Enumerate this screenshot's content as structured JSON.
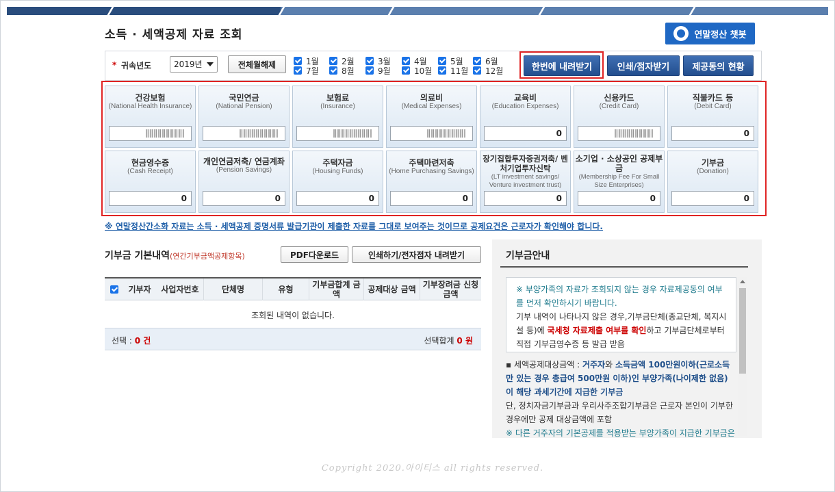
{
  "page": {
    "title": "소득 · 세액공제 자료 조회",
    "chatbot_label": "연말정산 챗봇"
  },
  "filter": {
    "required_mark": "*",
    "year_label": "귀속년도",
    "year_value": "2019년",
    "toggle_all_label": "전체월해제",
    "months": [
      "1월",
      "2월",
      "3월",
      "4월",
      "5월",
      "6월",
      "7월",
      "8월",
      "9월",
      "10월",
      "11월",
      "12월"
    ],
    "download_all_label": "한번에 내려받기",
    "print_label": "인쇄/점자받기",
    "provider_label": "제공동의 현황"
  },
  "cards": [
    {
      "title": "건강보험",
      "en": "(National Health Insurance)",
      "value": "",
      "masked": true
    },
    {
      "title": "국민연금",
      "en": "(National Pension)",
      "value": "",
      "masked": true
    },
    {
      "title": "보험료",
      "en": "(Insurance)",
      "value": "",
      "masked": true
    },
    {
      "title": "의료비",
      "en": "(Medical Expenses)",
      "value": "",
      "masked": true
    },
    {
      "title": "교육비",
      "en": "(Education Expenses)",
      "value": "0",
      "masked": false
    },
    {
      "title": "신용카드",
      "en": "(Credit Card)",
      "value": "",
      "masked": true
    },
    {
      "title": "직불카드 등",
      "en": "(Debit Card)",
      "value": "0",
      "masked": false
    },
    {
      "title": "현금영수증",
      "en": "(Cash Receipt)",
      "value": "0",
      "masked": false
    },
    {
      "title": "개인연금저축/ 연금계좌",
      "en": "(Pension Savings)",
      "value": "0",
      "masked": false
    },
    {
      "title": "주택자금",
      "en": "(Housing Funds)",
      "value": "0",
      "masked": false
    },
    {
      "title": "주택마련저축",
      "en": "(Home Purchasing Savings)",
      "value": "0",
      "masked": false
    },
    {
      "title": "장기집합투자증권저축/ 벤처기업투자신탁",
      "en": "(LT investment savings/ Venture investment trust)",
      "value": "0",
      "masked": false
    },
    {
      "title": "소기업 · 소상공인 공제부금",
      "en": "(Membership Fee For Small Size Enterprises)",
      "value": "0",
      "masked": false
    },
    {
      "title": "기부금",
      "en": "(Donation)",
      "value": "0",
      "masked": false
    }
  ],
  "notice": "※ 연말정산간소화 자료는 소득 · 세액공제 증명서류 발급기관이 제출한 자료를 그대로 보여주는 것이므로 공제요건은 근로자가 확인해야 합니다.",
  "donation": {
    "title": "기부금 기본내역",
    "subtitle": "(연간기부금액공제항목)",
    "pdf_label": "PDF다운로드",
    "print_label": "인쇄하기/전자점자 내려받기",
    "columns": [
      "기부자",
      "사업자번호",
      "단체명",
      "유형",
      "기부금합계 금액",
      "공제대상 금액",
      "기부장려금 신청금액"
    ],
    "empty_message": "조회된 내역이 없습니다.",
    "footer_selected_label": "선택 :",
    "footer_selected_count": "0 건",
    "footer_sum_label": "선택합계",
    "footer_sum_value": "0 원"
  },
  "guide": {
    "title": "기부금안내",
    "box_line1": "※ 부양가족의 자료가 조회되지 않는 경우 자료제공동의 여부를 먼저 확인하시기 바랍니다.",
    "box_line2_a": "기부 내역이 나타나지 않은 경우,기부금단체(종교단체, 복지시설 등)에 ",
    "box_line2_b": "국세청 자료제출 여부를 확인",
    "box_line2_c": "하고 기부금단체로부터 직접 기부금영수증 등 발급 받음",
    "text_a": "▪ 세액공제대상금액 : ",
    "text_b": "거주자",
    "text_c": "와 ",
    "text_d": "소득금액 100만원이하(근로소득만 있는 경우 총급여 500만원 이하)인 부양가족(나이제한 없음)이 해당 과세기간에 지급한 기부금",
    "text_e": "단, 정치자금기부금과 우리사주조합기부금은 근로자 본인이 기부한 경우에만 공제 대상금액에 포함",
    "text_f": "※ 다른 거주자의 기본공제를 적용받는 부양가족이 지급한 기부금은"
  },
  "copyright": "Copyright 2020.아이티스 all rights reserved."
}
